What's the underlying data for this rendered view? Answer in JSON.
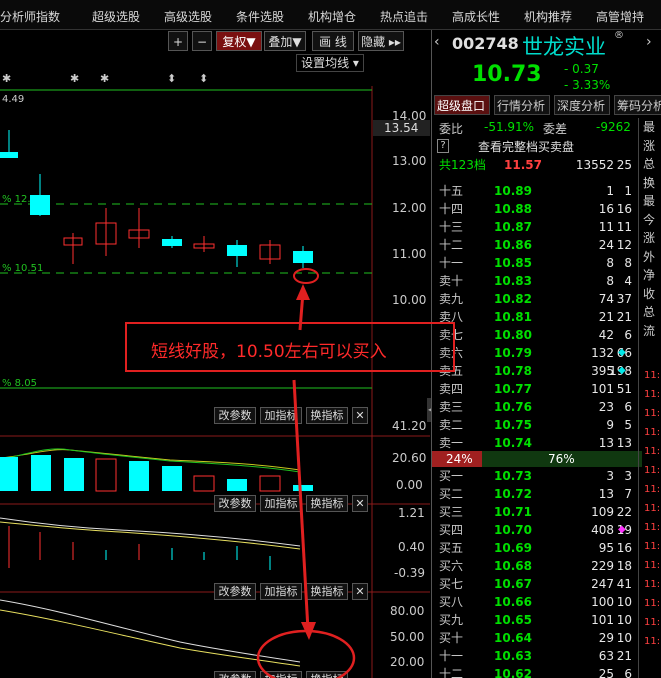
{
  "menu": [
    "分析师指数",
    "超级选股",
    "高级选股",
    "条件选股",
    "机构增仓",
    "热点追击",
    "高成长性",
    "机构推荐",
    "高管增持"
  ],
  "toolbar": {
    "plus": "+",
    "minus": "−",
    "fuquan": "复权▼",
    "diejia": "叠加▼",
    "huaxian": "画 线",
    "yincang": "隐藏 ▸▸",
    "settings": "设置均线 ▾"
  },
  "price_axis": [
    "14.00",
    "13.54",
    "13.00",
    "12.00",
    "11.00",
    "10.00"
  ],
  "chart_labels": {
    "top_level": "4.49",
    "line_12": "% 12.0",
    "line_1051": "% 10.51",
    "line_805": "% 8.05"
  },
  "panel_buttons": {
    "params": "改参数",
    "add_indicator": "加指标",
    "switch_indicator": "换指标",
    "close": "✕"
  },
  "vol_axis": [
    "41.20",
    "20.60",
    "0.00"
  ],
  "macd_axis": [
    "1.21",
    "0.40",
    "-0.39"
  ],
  "kdj_axis": [
    "80.00",
    "50.00",
    "20.00"
  ],
  "annotation": "短线好股，10.50左右可以买入",
  "stock": {
    "code": "002748",
    "name": "世龙实业",
    "price": "10.73",
    "change": "- 0.37",
    "change_pct": "- 3.33%"
  },
  "tabs": [
    "超级盘口",
    "行情分析",
    "深度分析",
    "筹码分析"
  ],
  "weibi": {
    "label": "委比",
    "value": "-51.91%",
    "diff_label": "委差",
    "diff_value": "-9262"
  },
  "full_book_link": "查看完整档买卖盘",
  "total_row": {
    "label": "共123档",
    "price": "11.57",
    "vol": "13552",
    "n": "25"
  },
  "sell_rows": [
    {
      "label": "十五",
      "price": "10.89",
      "vol": "1",
      "n": "1"
    },
    {
      "label": "十四",
      "price": "10.88",
      "vol": "16",
      "n": "16"
    },
    {
      "label": "十三",
      "price": "10.87",
      "vol": "11",
      "n": "11"
    },
    {
      "label": "十二",
      "price": "10.86",
      "vol": "24",
      "n": "12"
    },
    {
      "label": "十一",
      "price": "10.85",
      "vol": "8",
      "n": "8"
    },
    {
      "label": "卖十",
      "price": "10.83",
      "vol": "8",
      "n": "4"
    },
    {
      "label": "卖九",
      "price": "10.82",
      "vol": "74",
      "n": "37"
    },
    {
      "label": "卖八",
      "price": "10.81",
      "vol": "21",
      "n": "21"
    },
    {
      "label": "卖七",
      "price": "10.80",
      "vol": "42",
      "n": "6"
    },
    {
      "label": "卖六",
      "price": "10.79",
      "vol": "132",
      "n": "66",
      "mark": "cyan"
    },
    {
      "label": "卖五",
      "price": "10.78",
      "vol": "395",
      "n": "198",
      "mark": "cyan"
    },
    {
      "label": "卖四",
      "price": "10.77",
      "vol": "101",
      "n": "51"
    },
    {
      "label": "卖三",
      "price": "10.76",
      "vol": "23",
      "n": "6"
    },
    {
      "label": "卖二",
      "price": "10.75",
      "vol": "9",
      "n": "5"
    },
    {
      "label": "卖一",
      "price": "10.74",
      "vol": "13",
      "n": "13"
    }
  ],
  "ratio": {
    "left": "24%",
    "right": "76%",
    "left_fraction": 0.24
  },
  "buy_rows": [
    {
      "label": "买一",
      "price": "10.73",
      "vol": "3",
      "n": "3"
    },
    {
      "label": "买二",
      "price": "10.72",
      "vol": "13",
      "n": "7"
    },
    {
      "label": "买三",
      "price": "10.71",
      "vol": "109",
      "n": "22"
    },
    {
      "label": "买四",
      "price": "10.70",
      "vol": "408",
      "n": "19",
      "mark": "magenta"
    },
    {
      "label": "买五",
      "price": "10.69",
      "vol": "95",
      "n": "16"
    },
    {
      "label": "买六",
      "price": "10.68",
      "vol": "229",
      "n": "18"
    },
    {
      "label": "买七",
      "price": "10.67",
      "vol": "247",
      "n": "41"
    },
    {
      "label": "买八",
      "price": "10.66",
      "vol": "100",
      "n": "10"
    },
    {
      "label": "买九",
      "price": "10.65",
      "vol": "101",
      "n": "10"
    },
    {
      "label": "买十",
      "price": "10.64",
      "vol": "29",
      "n": "10"
    },
    {
      "label": "十一",
      "price": "10.63",
      "vol": "63",
      "n": "21"
    },
    {
      "label": "十二",
      "price": "10.62",
      "vol": "25",
      "n": "6"
    }
  ],
  "side_labels": [
    "最",
    "涨",
    "总",
    "换",
    "最",
    "今",
    "涨",
    "外",
    "净",
    "收",
    "总",
    "流"
  ],
  "side_times": [
    "11:",
    "11:",
    "11:",
    "11:",
    "11:",
    "11:",
    "11:",
    "11:",
    "11:",
    "11:",
    "11:",
    "11:",
    "11:",
    "11:",
    "11:"
  ],
  "colors": {
    "up": "#ff3030",
    "down": "#00ffff",
    "buy_green": "#00e000",
    "stock_name": "#00dccc",
    "accent_red": "#e02020"
  }
}
